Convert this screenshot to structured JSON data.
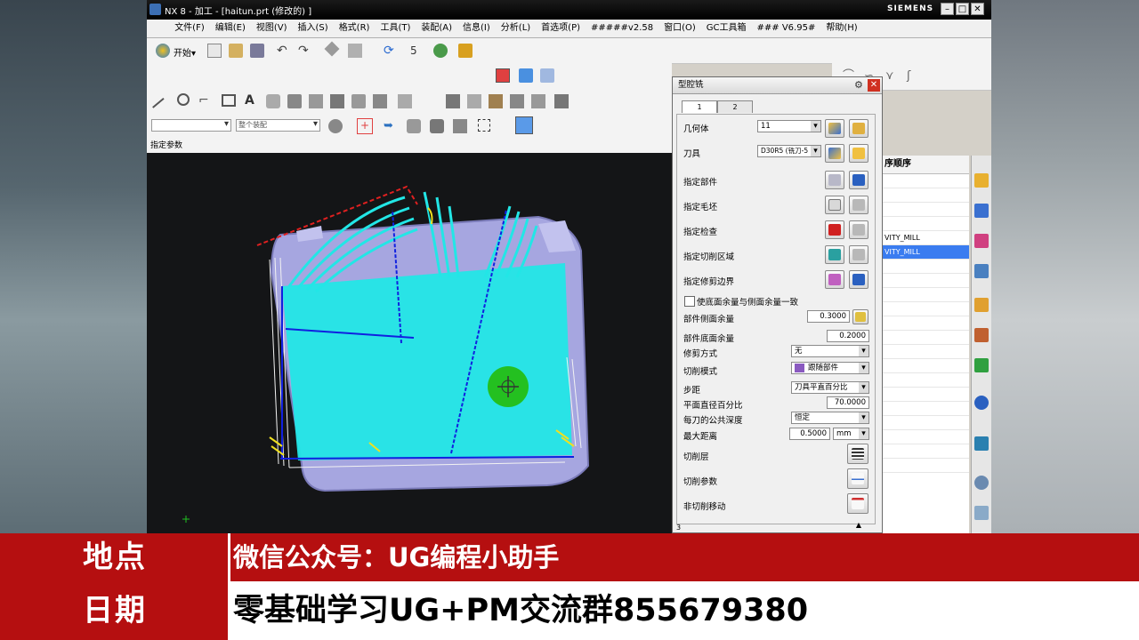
{
  "window": {
    "title": "NX 8 - 加工 - [haitun.prt  (修改的) ]",
    "brand": "SIEMENS"
  },
  "menu": [
    "文件(F)",
    "编辑(E)",
    "视图(V)",
    "插入(S)",
    "格式(R)",
    "工具(T)",
    "装配(A)",
    "信息(I)",
    "分析(L)",
    "首选项(P)",
    "#####v2.58",
    "窗口(O)",
    "GC工具箱",
    "### V6.95#",
    "帮助(H)"
  ],
  "toolbar": {
    "start_label": "开始▾",
    "filter_placeholder": "",
    "snap_value": "整个装配"
  },
  "prompt": "指定参数",
  "navigator": {
    "header": "序顺序",
    "rows": [
      "",
      "",
      "",
      "",
      "VITY_MILL",
      "",
      "",
      "",
      "",
      "",
      "",
      "",
      "",
      "",
      "",
      "",
      "",
      "",
      "",
      "",
      ""
    ]
  },
  "dialog": {
    "title": "型腔铣",
    "tabs": [
      "1",
      "2"
    ],
    "geometry_label": "几何体",
    "geometry_value": "11",
    "tool_label": "刀具",
    "tool_value": "D30R5 (铣刀-5",
    "specify_part": "指定部件",
    "specify_blank": "指定毛坯",
    "specify_check": "指定检查",
    "specify_cut_area": "指定切削区域",
    "specify_trim": "指定修剪边界",
    "floor_same_wall": "使底面余量与侧面余量一致",
    "part_side_stock_label": "部件侧面余量",
    "part_side_stock_value": "0.3000",
    "part_floor_stock_label": "部件底面余量",
    "part_floor_stock_value": "0.2000",
    "trim_method_label": "修剪方式",
    "trim_method_value": "无",
    "cut_pattern_label": "切削模式",
    "cut_pattern_value": "跟随部件",
    "stepover_label": "步距",
    "stepover_value": "刀具平直百分比",
    "percent_label": "平面直径百分比",
    "percent_value": "70.0000",
    "depth_label": "每刀的公共深度",
    "depth_value": "恒定",
    "max_dist_label": "最大距离",
    "max_dist_value": "0.5000",
    "max_dist_unit": "mm",
    "cut_levels": "切削层",
    "cut_params": "切削参数",
    "non_cut_moves": "非切削移动",
    "footer": "3"
  },
  "banner": {
    "label1": "地点",
    "value1": "微信公众号：UG编程小助手",
    "label2": "日期",
    "value2": "零基础学习UG+PM交流群855679380"
  },
  "colors": {
    "banner_red": "#b50f10",
    "toolpath_cyan": "#22e6e6",
    "toolpath_blue": "#1020e0",
    "part_color": "#a6a6e0",
    "highlight": "#3a7cf0"
  }
}
